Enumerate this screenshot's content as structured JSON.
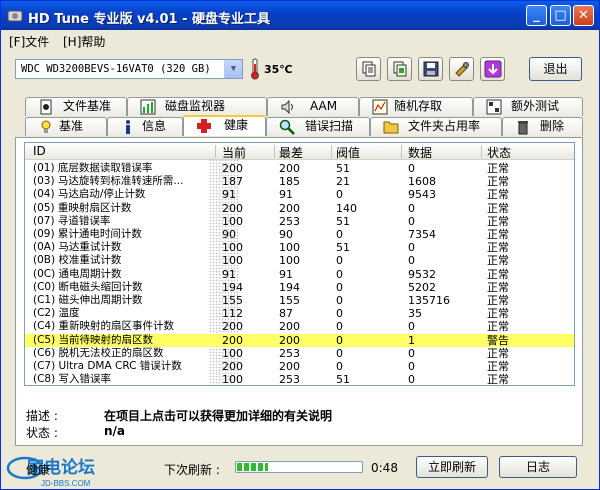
{
  "window": {
    "title": "HD Tune  专业版  v4.01  -  硬盘专业工具",
    "buttons": {
      "minimize": "_",
      "maximize": "□",
      "close": "✕"
    }
  },
  "menu": [
    {
      "label": "[F]文件"
    },
    {
      "label": "[H]帮助"
    }
  ],
  "toolbar": {
    "drive": "WDC WD3200BEVS-16VAT0 (320 GB)",
    "temperature": "35℃",
    "exit_label": "退出",
    "icons": [
      "copy-text-icon",
      "copy-screen-icon",
      "save-icon",
      "options-icon",
      "download-icon"
    ]
  },
  "tabs_row1": [
    {
      "label": "文件基准",
      "icon": "file-benchmark-icon"
    },
    {
      "label": "磁盘监视器",
      "icon": "disk-monitor-icon"
    },
    {
      "label": "AAM",
      "icon": "speaker-icon"
    },
    {
      "label": "随机存取",
      "icon": "random-access-icon"
    },
    {
      "label": "额外测试",
      "icon": "extra-tests-icon"
    }
  ],
  "tabs_row2": [
    {
      "label": "基准",
      "icon": "benchmark-icon"
    },
    {
      "label": "信息",
      "icon": "info-icon"
    },
    {
      "label": "健康",
      "icon": "health-cross-icon",
      "active": true
    },
    {
      "label": "错误扫描",
      "icon": "error-scan-icon"
    },
    {
      "label": "文件夹占用率",
      "icon": "folder-icon"
    },
    {
      "label": "删除",
      "icon": "trash-icon"
    }
  ],
  "table": {
    "columns": [
      "ID",
      "当前",
      "最差",
      "阀值",
      "数据",
      "状态"
    ],
    "rows": [
      [
        "(01) 底层数据读取错误率",
        "200",
        "200",
        "51",
        "0",
        "正常"
      ],
      [
        "(03) 马达旋转到标准转速所需...",
        "187",
        "185",
        "21",
        "1608",
        "正常"
      ],
      [
        "(04) 马达启动/停止计数",
        "91",
        "91",
        "0",
        "9543",
        "正常"
      ],
      [
        "(05) 重映射扇区计数",
        "200",
        "200",
        "140",
        "0",
        "正常"
      ],
      [
        "(07) 寻道错误率",
        "100",
        "253",
        "51",
        "0",
        "正常"
      ],
      [
        "(09) 累计通电时间计数",
        "90",
        "90",
        "0",
        "7354",
        "正常"
      ],
      [
        "(0A) 马达重试计数",
        "100",
        "100",
        "51",
        "0",
        "正常"
      ],
      [
        "(0B) 校准重试计数",
        "100",
        "100",
        "0",
        "0",
        "正常"
      ],
      [
        "(0C) 通电周期计数",
        "91",
        "91",
        "0",
        "9532",
        "正常"
      ],
      [
        "(C0) 断电磁头缩回计数",
        "194",
        "194",
        "0",
        "5202",
        "正常"
      ],
      [
        "(C1) 磁头伸出周期计数",
        "155",
        "155",
        "0",
        "135716",
        "正常"
      ],
      [
        "(C2) 温度",
        "112",
        "87",
        "0",
        "35",
        "正常"
      ],
      [
        "(C4) 重新映射的扇区事件计数",
        "200",
        "200",
        "0",
        "0",
        "正常"
      ],
      [
        "(C5) 当前待映射的扇区数",
        "200",
        "200",
        "0",
        "1",
        "警告"
      ],
      [
        "(C6) 脱机无法校正的扇区数",
        "100",
        "253",
        "0",
        "0",
        "正常"
      ],
      [
        "(C7) Ultra DMA CRC 错误计数",
        "200",
        "200",
        "0",
        "0",
        "正常"
      ],
      [
        "(C8) 写入错误率",
        "100",
        "253",
        "51",
        "0",
        "正常"
      ]
    ],
    "highlight_row": 13
  },
  "details": {
    "desc_label": "描述 :",
    "desc_value": "在项目上点击可以获得更加详细的有关说明",
    "status_label": "状态 :",
    "status_value": "n/a"
  },
  "bottom": {
    "health_label": "健康",
    "next_refresh_label": "下次刷新 :",
    "progress": 0.25,
    "countdown": "0:48",
    "refresh_button": "立即刷新",
    "log_button": "日志",
    "watermark_logo": "家电论坛",
    "watermark_url": "JD-BBS.COM"
  }
}
